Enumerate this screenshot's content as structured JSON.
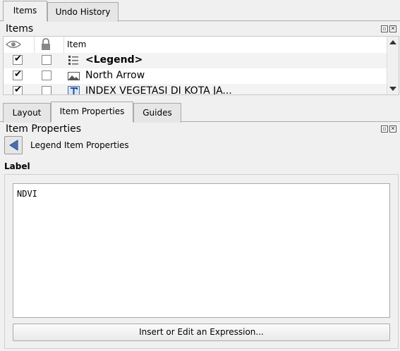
{
  "top_tabs": [
    {
      "label": "Items",
      "active": true
    },
    {
      "label": "Undo History",
      "active": false
    }
  ],
  "items_panel": {
    "title": "Items",
    "columns": [
      "",
      "",
      "Item"
    ],
    "rows": [
      {
        "visible": true,
        "locked": false,
        "label": "<Legend>",
        "icon": "legend-icon",
        "bold": true
      },
      {
        "visible": true,
        "locked": false,
        "label": "North Arrow",
        "icon": "picture-icon",
        "bold": false
      },
      {
        "visible": true,
        "locked": false,
        "label": "INDEX VEGETASI DI KOTA JA...",
        "icon": "text-label-icon",
        "bold": false
      }
    ]
  },
  "bottom_tabs": [
    {
      "label": "Layout",
      "active": false
    },
    {
      "label": "Item Properties",
      "active": true
    },
    {
      "label": "Guides",
      "active": false
    }
  ],
  "item_properties": {
    "title": "Item Properties",
    "subtitle": "Legend Item Properties",
    "section_label": "Label",
    "label_value": "NDVI",
    "expression_button": "Insert or Edit an Expression..."
  },
  "colors": {
    "panel_bg": "#f0f0f0",
    "back_arrow": "#4a6fb3"
  }
}
